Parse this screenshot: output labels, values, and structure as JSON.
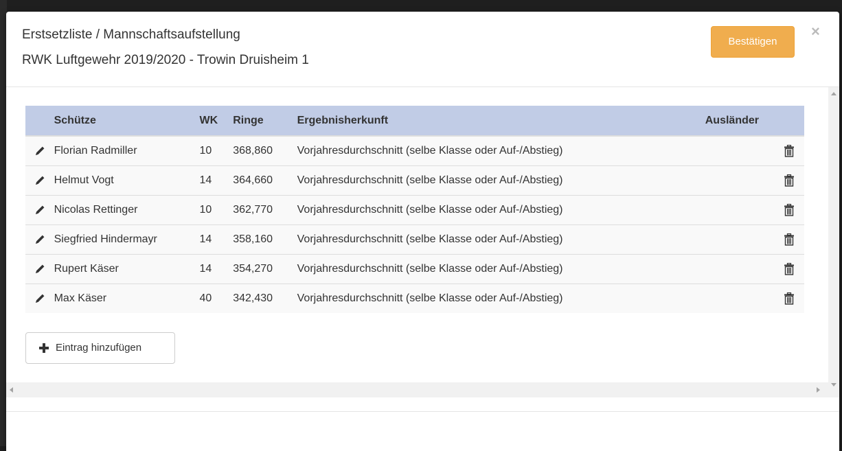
{
  "modal": {
    "title_line1": "Erstsetzliste / Mannschaftsaufstellung",
    "title_line2": "RWK Luftgewehr 2019/2020 - Trowin Druisheim 1",
    "confirm_label": "Bestätigen",
    "close_label": "×",
    "accent_color": "#f0ad4e",
    "header_row_color": "#c1cce6"
  },
  "table": {
    "columns": {
      "schuetze": "Schütze",
      "wk": "WK",
      "ringe": "Ringe",
      "herkunft": "Ergebnisherkunft",
      "auslaender": "Ausländer"
    },
    "rows": [
      {
        "name": "Florian Radmiller",
        "wk": "10",
        "ringe": "368,860",
        "herkunft": "Vorjahresdurchschnitt (selbe Klasse oder Auf-/Abstieg)"
      },
      {
        "name": "Helmut Vogt",
        "wk": "14",
        "ringe": "364,660",
        "herkunft": "Vorjahresdurchschnitt (selbe Klasse oder Auf-/Abstieg)"
      },
      {
        "name": "Nicolas Rettinger",
        "wk": "10",
        "ringe": "362,770",
        "herkunft": "Vorjahresdurchschnitt (selbe Klasse oder Auf-/Abstieg)"
      },
      {
        "name": "Siegfried Hindermayr",
        "wk": "14",
        "ringe": "358,160",
        "herkunft": "Vorjahresdurchschnitt (selbe Klasse oder Auf-/Abstieg)"
      },
      {
        "name": "Rupert Käser",
        "wk": "14",
        "ringe": "354,270",
        "herkunft": "Vorjahresdurchschnitt (selbe Klasse oder Auf-/Abstieg)"
      },
      {
        "name": "Max Käser",
        "wk": "40",
        "ringe": "342,430",
        "herkunft": "Vorjahresdurchschnitt (selbe Klasse oder Auf-/Abstieg)"
      }
    ],
    "row_icons": {
      "edit": "pencil-icon",
      "delete": "trash-icon"
    }
  },
  "add_entry": {
    "label": "Eintrag hinzufügen",
    "icon": "plus-icon"
  }
}
